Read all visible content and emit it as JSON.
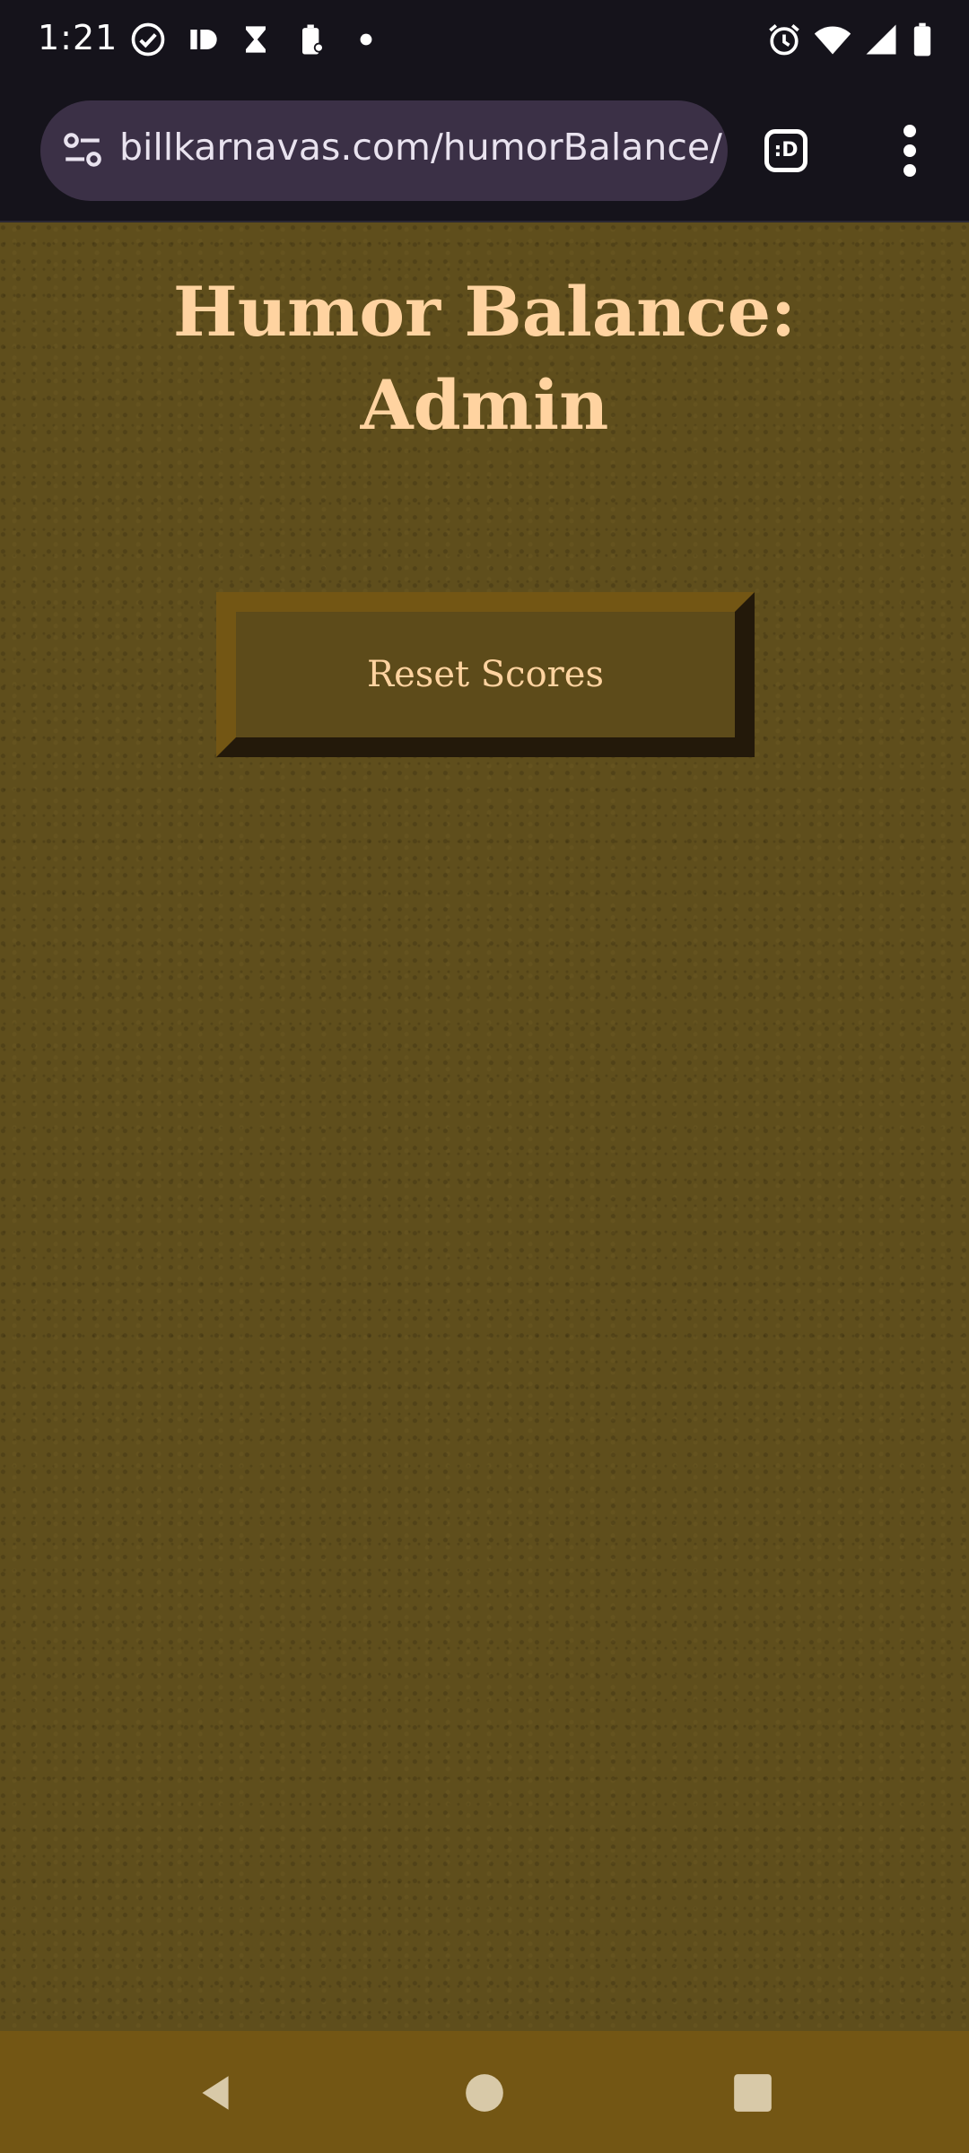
{
  "status_bar": {
    "time": "1:21",
    "icons": [
      "check-circle-icon",
      "app-badge-icon",
      "hourglass-icon",
      "battery-saver-icon",
      "dot-icon",
      "alarm-icon",
      "wifi-icon",
      "signal-icon",
      "battery-icon"
    ]
  },
  "browser": {
    "url": "billkarnavas.com/humorBalance/",
    "tab_label": ":D"
  },
  "page": {
    "title": "Humor Balance: Admin",
    "reset_button_label": "Reset Scores"
  },
  "colors": {
    "background": "#5f4e1c",
    "title": "#ffd3a0",
    "nav_bar": "#735614",
    "browser_chrome": "#15131b",
    "url_bar": "#3b3046"
  },
  "nav_bar": {
    "buttons": [
      "back-icon",
      "home-icon",
      "recents-icon"
    ]
  }
}
